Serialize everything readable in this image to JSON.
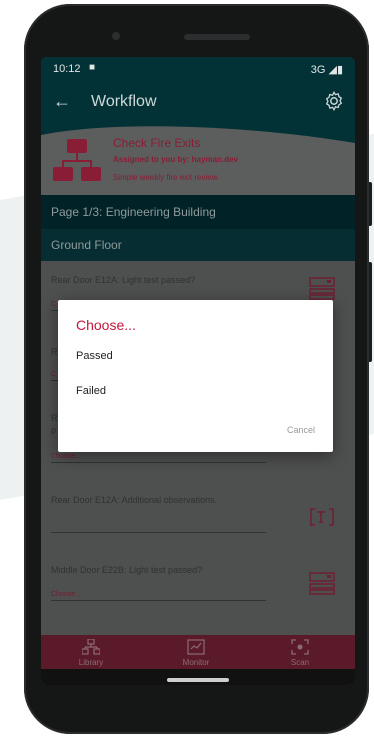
{
  "status_bar": {
    "time": "10:12",
    "network": "3G"
  },
  "app_bar": {
    "title": "Workflow",
    "back_icon": "arrow-left-icon",
    "settings_icon": "gear-icon"
  },
  "header": {
    "title": "Check Fire Exits",
    "assigned": "Assigned to you by: hayman.dev",
    "description": "Simple weekly fire exit review."
  },
  "page_label": "Page 1/3: Engineering Building",
  "section_label": "Ground Floor",
  "questions": [
    {
      "text": "Rear Door E12A: Light test passed?",
      "select_placeholder": "C",
      "icon": "keyboard-select-icon"
    },
    {
      "text": "R",
      "select_placeholder": "C",
      "icon": ""
    },
    {
      "text": "R",
      "text2": "p",
      "select_placeholder": "Choose...",
      "icon": ""
    },
    {
      "text": "Rear Door E12A: Additional observations.",
      "select_placeholder": "",
      "icon": "text-input-icon"
    },
    {
      "text": "Middle Door E22B: Light test passed?",
      "select_placeholder": "Choose...",
      "icon": "keyboard-select-icon"
    }
  ],
  "bottom_nav": [
    {
      "label": "Library",
      "icon": "hierarchy-icon"
    },
    {
      "label": "Monitor",
      "icon": "monitor-icon"
    },
    {
      "label": "Scan",
      "icon": "scan-icon"
    }
  ],
  "dialog": {
    "title": "Choose...",
    "options": [
      "Passed",
      "Failed"
    ],
    "cancel_label": "Cancel"
  },
  "colors": {
    "primary_dark": "#023236",
    "accent": "#c3163f",
    "nav_bg": "#5a1a29"
  }
}
